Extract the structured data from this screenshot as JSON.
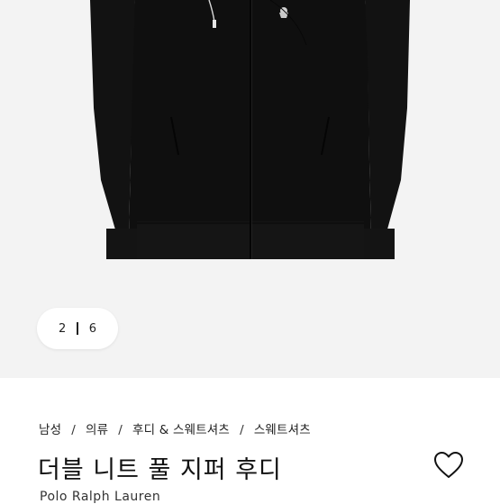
{
  "gallery": {
    "current": "2",
    "total": "6",
    "background": "#f3f3f3",
    "product_color": "#101010"
  },
  "breadcrumb": [
    "남성",
    "의류",
    "후디 & 스웨트셔츠",
    "스웨트셔츠"
  ],
  "product": {
    "title": "더블 니트 풀 지퍼 후디",
    "brand": "Polo Ralph Lauren"
  },
  "icons": {
    "wishlist": "heart-outline-icon"
  }
}
